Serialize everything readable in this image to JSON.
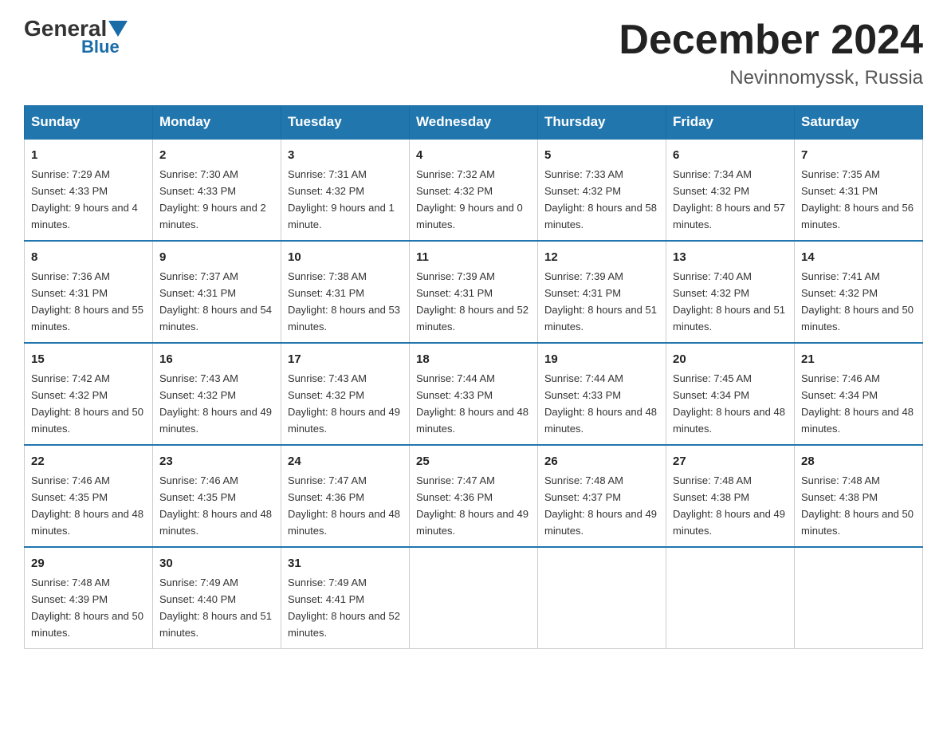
{
  "header": {
    "logo_general": "General",
    "logo_blue": "Blue",
    "month_title": "December 2024",
    "location": "Nevinnomyssk, Russia"
  },
  "days_of_week": [
    "Sunday",
    "Monday",
    "Tuesday",
    "Wednesday",
    "Thursday",
    "Friday",
    "Saturday"
  ],
  "weeks": [
    [
      {
        "day": "1",
        "sunrise": "7:29 AM",
        "sunset": "4:33 PM",
        "daylight": "9 hours and 4 minutes."
      },
      {
        "day": "2",
        "sunrise": "7:30 AM",
        "sunset": "4:33 PM",
        "daylight": "9 hours and 2 minutes."
      },
      {
        "day": "3",
        "sunrise": "7:31 AM",
        "sunset": "4:32 PM",
        "daylight": "9 hours and 1 minute."
      },
      {
        "day": "4",
        "sunrise": "7:32 AM",
        "sunset": "4:32 PM",
        "daylight": "9 hours and 0 minutes."
      },
      {
        "day": "5",
        "sunrise": "7:33 AM",
        "sunset": "4:32 PM",
        "daylight": "8 hours and 58 minutes."
      },
      {
        "day": "6",
        "sunrise": "7:34 AM",
        "sunset": "4:32 PM",
        "daylight": "8 hours and 57 minutes."
      },
      {
        "day": "7",
        "sunrise": "7:35 AM",
        "sunset": "4:31 PM",
        "daylight": "8 hours and 56 minutes."
      }
    ],
    [
      {
        "day": "8",
        "sunrise": "7:36 AM",
        "sunset": "4:31 PM",
        "daylight": "8 hours and 55 minutes."
      },
      {
        "day": "9",
        "sunrise": "7:37 AM",
        "sunset": "4:31 PM",
        "daylight": "8 hours and 54 minutes."
      },
      {
        "day": "10",
        "sunrise": "7:38 AM",
        "sunset": "4:31 PM",
        "daylight": "8 hours and 53 minutes."
      },
      {
        "day": "11",
        "sunrise": "7:39 AM",
        "sunset": "4:31 PM",
        "daylight": "8 hours and 52 minutes."
      },
      {
        "day": "12",
        "sunrise": "7:39 AM",
        "sunset": "4:31 PM",
        "daylight": "8 hours and 51 minutes."
      },
      {
        "day": "13",
        "sunrise": "7:40 AM",
        "sunset": "4:32 PM",
        "daylight": "8 hours and 51 minutes."
      },
      {
        "day": "14",
        "sunrise": "7:41 AM",
        "sunset": "4:32 PM",
        "daylight": "8 hours and 50 minutes."
      }
    ],
    [
      {
        "day": "15",
        "sunrise": "7:42 AM",
        "sunset": "4:32 PM",
        "daylight": "8 hours and 50 minutes."
      },
      {
        "day": "16",
        "sunrise": "7:43 AM",
        "sunset": "4:32 PM",
        "daylight": "8 hours and 49 minutes."
      },
      {
        "day": "17",
        "sunrise": "7:43 AM",
        "sunset": "4:32 PM",
        "daylight": "8 hours and 49 minutes."
      },
      {
        "day": "18",
        "sunrise": "7:44 AM",
        "sunset": "4:33 PM",
        "daylight": "8 hours and 48 minutes."
      },
      {
        "day": "19",
        "sunrise": "7:44 AM",
        "sunset": "4:33 PM",
        "daylight": "8 hours and 48 minutes."
      },
      {
        "day": "20",
        "sunrise": "7:45 AM",
        "sunset": "4:34 PM",
        "daylight": "8 hours and 48 minutes."
      },
      {
        "day": "21",
        "sunrise": "7:46 AM",
        "sunset": "4:34 PM",
        "daylight": "8 hours and 48 minutes."
      }
    ],
    [
      {
        "day": "22",
        "sunrise": "7:46 AM",
        "sunset": "4:35 PM",
        "daylight": "8 hours and 48 minutes."
      },
      {
        "day": "23",
        "sunrise": "7:46 AM",
        "sunset": "4:35 PM",
        "daylight": "8 hours and 48 minutes."
      },
      {
        "day": "24",
        "sunrise": "7:47 AM",
        "sunset": "4:36 PM",
        "daylight": "8 hours and 48 minutes."
      },
      {
        "day": "25",
        "sunrise": "7:47 AM",
        "sunset": "4:36 PM",
        "daylight": "8 hours and 49 minutes."
      },
      {
        "day": "26",
        "sunrise": "7:48 AM",
        "sunset": "4:37 PM",
        "daylight": "8 hours and 49 minutes."
      },
      {
        "day": "27",
        "sunrise": "7:48 AM",
        "sunset": "4:38 PM",
        "daylight": "8 hours and 49 minutes."
      },
      {
        "day": "28",
        "sunrise": "7:48 AM",
        "sunset": "4:38 PM",
        "daylight": "8 hours and 50 minutes."
      }
    ],
    [
      {
        "day": "29",
        "sunrise": "7:48 AM",
        "sunset": "4:39 PM",
        "daylight": "8 hours and 50 minutes."
      },
      {
        "day": "30",
        "sunrise": "7:49 AM",
        "sunset": "4:40 PM",
        "daylight": "8 hours and 51 minutes."
      },
      {
        "day": "31",
        "sunrise": "7:49 AM",
        "sunset": "4:41 PM",
        "daylight": "8 hours and 52 minutes."
      },
      null,
      null,
      null,
      null
    ]
  ]
}
